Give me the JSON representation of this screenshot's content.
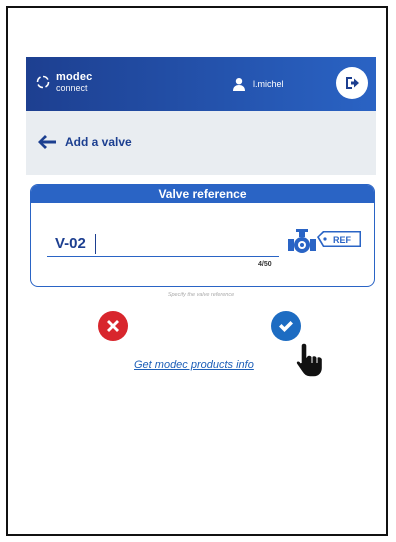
{
  "header": {
    "brand": "modec",
    "brand_sub": "connect",
    "username": "l.michel"
  },
  "subbar": {
    "title": "Add a valve"
  },
  "form": {
    "card_title": "Valve reference",
    "reference_value": "V-02",
    "counter": "4/50",
    "ref_badge": "REF",
    "hint": "Specify the valve reference"
  },
  "actions": {
    "info_link": "Get modec products info"
  },
  "colors": {
    "header_start": "#1d3f90",
    "header_end": "#2a63c4",
    "accent": "#2a64c5",
    "cancel": "#d8262d",
    "confirm": "#1d6cc2",
    "subbar_bg": "#e9edf1"
  },
  "icons": [
    "modec-logo-icon",
    "user-icon",
    "logout-icon",
    "back-arrow-icon",
    "valve-ref-icon",
    "close-icon",
    "check-icon",
    "hand-pointer-icon"
  ]
}
